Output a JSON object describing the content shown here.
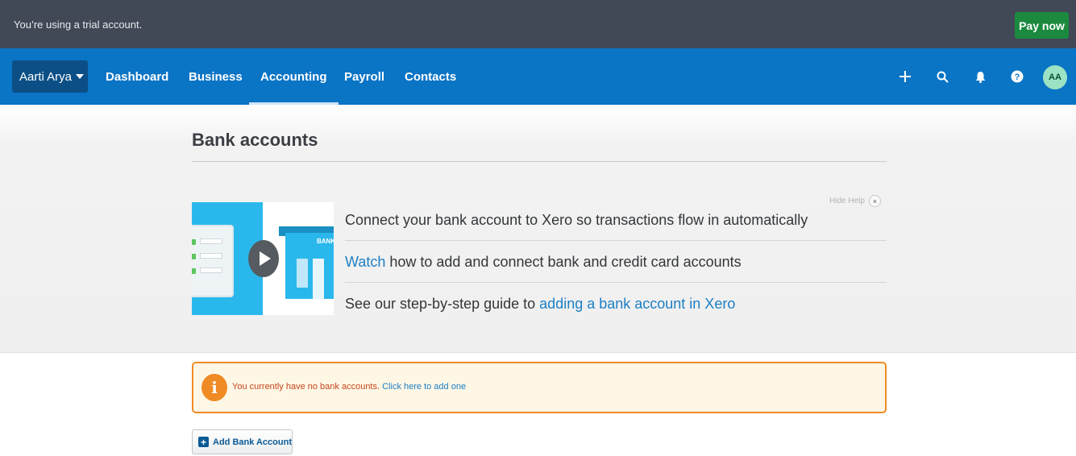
{
  "trial_bar": {
    "message": "You’re using a trial account.",
    "pay_now_label": "Pay now"
  },
  "nav": {
    "org_name": "Aarti Arya",
    "items": [
      {
        "label": "Dashboard"
      },
      {
        "label": "Business"
      },
      {
        "label": "Accounting"
      },
      {
        "label": "Payroll"
      },
      {
        "label": "Contacts"
      }
    ],
    "active_item": "Accounting",
    "icons": [
      "plus-icon",
      "search-icon",
      "bell-icon",
      "help-icon"
    ],
    "avatar_initials": "AA"
  },
  "page": {
    "title": "Bank accounts"
  },
  "help": {
    "hide_label": "Hide Help",
    "close_glyph": "×",
    "thumbnail_sign": "BANK",
    "line1": "Connect your bank account to Xero so transactions flow in automatically",
    "line2_link": "Watch",
    "line2_text": " how to add and connect bank and credit card accounts",
    "line3_text": "See our step-by-step guide to ",
    "line3_link": "adding a bank account in Xero"
  },
  "alert": {
    "icon_glyph": "i",
    "message": "You currently have no bank accounts.",
    "link": "Click here to add one"
  },
  "actions": {
    "add_bank_account_label": "Add Bank Account",
    "add_glyph": "+"
  },
  "colors": {
    "trial_bar_bg": "#414856",
    "nav_bg": "#0a74c5",
    "pay_now_bg": "#1b8a3f",
    "link": "#1c7fc4",
    "alert_border": "#f08a24"
  }
}
